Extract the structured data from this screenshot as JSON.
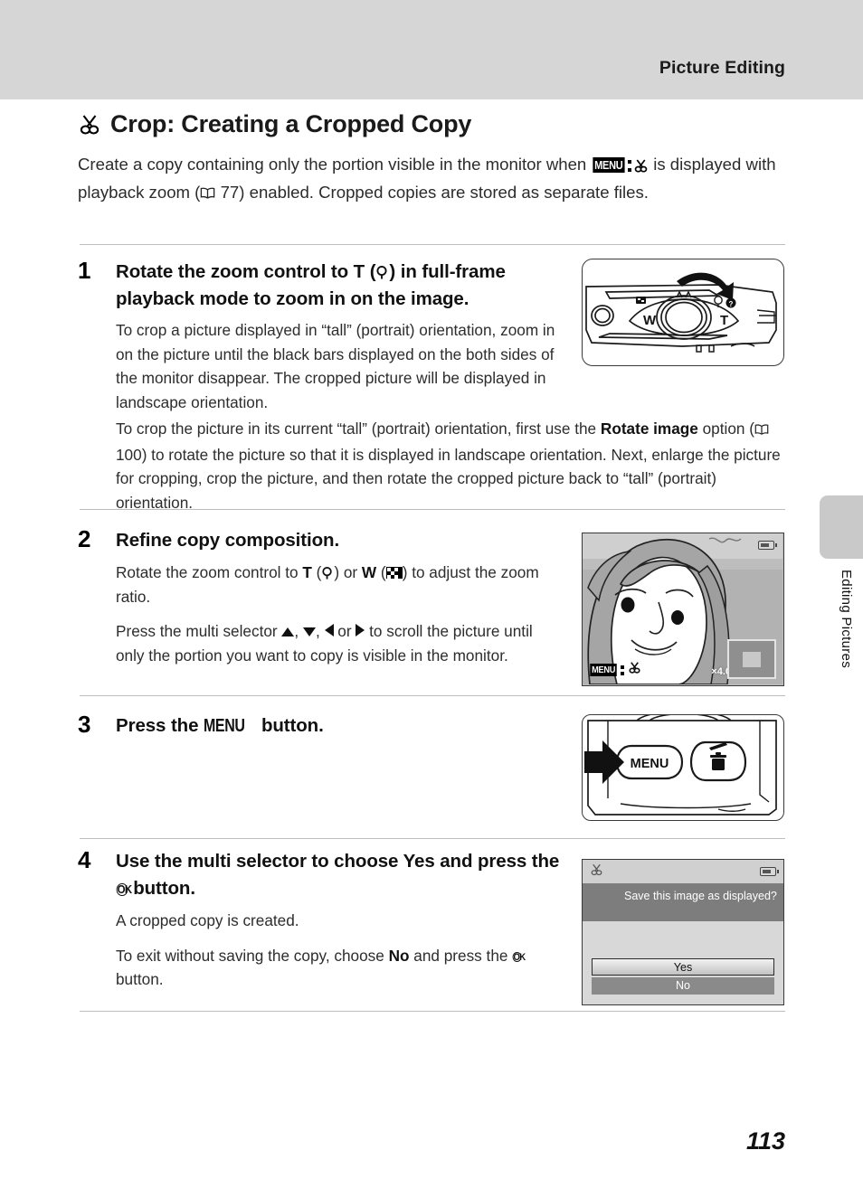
{
  "header": {
    "title": "Picture Editing"
  },
  "heading": {
    "icon": "scissors-icon",
    "text": "Crop: Creating a Cropped Copy"
  },
  "intro": {
    "part1": "Create a copy containing only the portion visible in the monitor when ",
    "menu_label": "MENU",
    "scissors_icon": "scissors-icon",
    "part2": " is displayed with playback zoom (",
    "book_icon": "book-icon",
    "page_ref": "77",
    "part3": ") enabled. Cropped copies are stored as separate files."
  },
  "steps": [
    {
      "number": "1",
      "title_a": "Rotate the zoom control to ",
      "title_t": "T",
      "title_paren_open": " (",
      "title_zoom_icon": "magnifier-icon",
      "title_paren_close": ") in full-frame playback mode to zoom in on the image.",
      "body1": "To crop a picture displayed in “tall” (portrait) orientation, zoom in on the picture until the black bars displayed on the both sides of the monitor disappear. The cropped picture will be displayed in landscape orientation.",
      "body2_a": "To crop the picture in its current “tall” (portrait) orientation, first use the ",
      "body2_bold": "Rotate image",
      "body2_b": " option (",
      "body2_book": "book-icon",
      "body2_page": "100",
      "body2_c": ") to rotate the picture so that it is displayed in landscape orientation. Next, enlarge the picture for cropping, crop the picture, and then rotate the cropped picture back to “tall” (portrait) orientation.",
      "figure": "camera-top-zoom-control",
      "figure_labels": {
        "wide": "W",
        "tele": "T"
      }
    },
    {
      "number": "2",
      "title": "Refine copy composition.",
      "body1_a": "Rotate the zoom control to ",
      "body1_t": "T",
      "body1_b": " (",
      "body1_zoom_icon": "magnifier-icon",
      "body1_c": ") or ",
      "body1_w": "W",
      "body1_d": " (",
      "body1_wide_icon": "thumbnail-icon",
      "body1_e": ") to adjust the zoom ratio.",
      "body2_a": "Press the multi selector ",
      "body2_b": ", ",
      "body2_c": ", ",
      "body2_d": " or ",
      "body2_e": " to scroll the picture until only the portion you want to copy is visible in the monitor.",
      "figure": "monitor-portrait-crop-preview",
      "figure_osd": {
        "menu_label": "MENU",
        "zoom_ratio": "×4.0"
      }
    },
    {
      "number": "3",
      "title_a": "Press the ",
      "title_menu": "MENU",
      "title_b": " button.",
      "figure": "camera-back-menu-button",
      "figure_labels": {
        "menu": "MENU",
        "delete": "trash-icon"
      }
    },
    {
      "number": "4",
      "title_a": "Use the multi selector to choose ",
      "title_bold": "Yes",
      "title_b": " and press the ",
      "title_ok": "ok-button-icon",
      "title_c": " button.",
      "body1": "A cropped copy is created.",
      "body2_a": "To exit without saving the copy, choose ",
      "body2_bold": "No",
      "body2_b": " and press the ",
      "body2_ok": "ok-button-icon",
      "body2_c": " button.",
      "figure": "confirm-save-dialog",
      "dialog": {
        "icon": "scissors-icon",
        "battery_icon": "battery-icon",
        "message": "Save this image as displayed?",
        "option_yes": "Yes",
        "option_no": "No"
      }
    }
  ],
  "side_tab": {
    "label": "Editing Pictures"
  },
  "footer": {
    "page_number": "113"
  }
}
